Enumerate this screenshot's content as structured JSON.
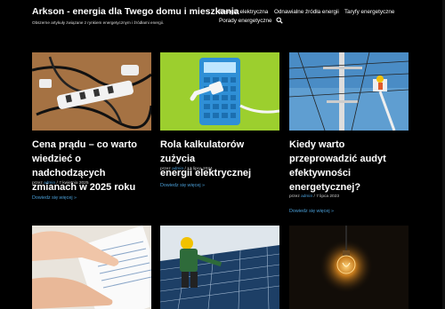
{
  "site": {
    "title": "Arkson - energia dla Twego domu i mieszkania",
    "tagline": "Obszerne artykuły związane z rynkiem energetycznym i źródłami energii."
  },
  "nav": {
    "items": [
      {
        "label": "Energia elektryczna"
      },
      {
        "label": "Odnawialne źródła energii"
      },
      {
        "label": "Taryfy energetyczne"
      },
      {
        "label": "Porady energetyczne"
      }
    ],
    "search_icon": "search-icon"
  },
  "posts": [
    {
      "title_lines": [
        "Cena prądu – co warto",
        "wiedzieć o nadchodzących",
        "zmianach w 2025 roku"
      ],
      "by": "przez",
      "author": "admin",
      "sep": "/",
      "date": "7 kwietnia 2025",
      "more": "Dowiedz się więcej »",
      "image": "power-strip-with-plugs"
    },
    {
      "title_lines": [
        "Rola kalkulatorów zużycia",
        "energii elektrycznej"
      ],
      "by": "przez",
      "author": "admin",
      "sep": "/",
      "date": "13 lipca 2024",
      "more": "Dowiedz się więcej »",
      "image": "calculator-with-plug"
    },
    {
      "title_lines": [
        "Kiedy warto",
        "przeprowadzić audyt",
        "efektywności",
        "energetycznej?"
      ],
      "by": "przez",
      "author": "admin",
      "sep": "/",
      "date": "7 lipca 2023",
      "more": "Dowiedz się więcej »",
      "image": "power-line-technician"
    }
  ],
  "bottom_images": [
    "hands-pointing-at-document",
    "worker-installing-solar-panels",
    "glowing-light-bulb"
  ]
}
